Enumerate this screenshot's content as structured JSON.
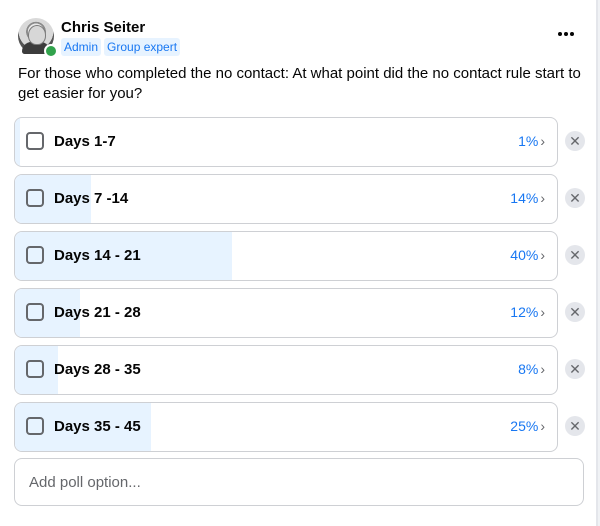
{
  "post": {
    "author": {
      "name": "Chris Seiter",
      "badges": [
        "Admin",
        "Group expert"
      ],
      "online": true
    },
    "question": "For those who completed the no contact: At what point did the no contact rule start to get easier for you?",
    "more_icon": "more-dots-icon"
  },
  "poll": {
    "options": [
      {
        "label": "Days 1-7",
        "percent_text": "1%",
        "percent": 1
      },
      {
        "label": "Days 7 -14",
        "percent_text": "14%",
        "percent": 14
      },
      {
        "label": "Days 14 - 21",
        "percent_text": "40%",
        "percent": 40
      },
      {
        "label": "Days 21 - 28",
        "percent_text": "12%",
        "percent": 12
      },
      {
        "label": "Days 28 - 35",
        "percent_text": "8%",
        "percent": 8
      },
      {
        "label": "Days 35 - 45",
        "percent_text": "25%",
        "percent": 25
      }
    ],
    "add_option_placeholder": "Add poll option...",
    "colors": {
      "accent": "#1877f2",
      "fill": "#e7f3ff",
      "online": "#31a24c"
    }
  }
}
